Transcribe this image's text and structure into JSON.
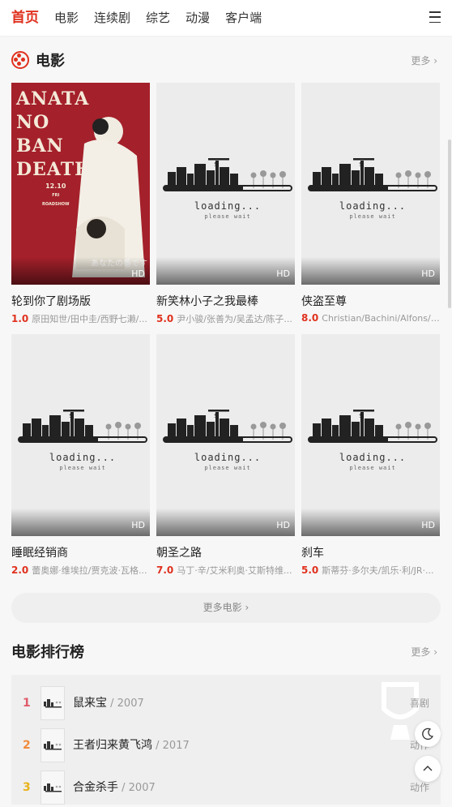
{
  "nav": {
    "items": [
      "首页",
      "电影",
      "连续剧",
      "综艺",
      "动漫",
      "客户端"
    ]
  },
  "movies_section": {
    "title": "电影",
    "more": "更多",
    "more_button": "更多电影",
    "cards": [
      {
        "title": "轮到你了剧场版",
        "score": "1.0",
        "cast": "原田知世/田中圭/西野七濑/...",
        "badge": "HD"
      },
      {
        "title": "新笑林小子之我最棒",
        "score": "5.0",
        "cast": "尹小骏/张善为/吴孟达/陈子...",
        "badge": "HD"
      },
      {
        "title": "侠盗至尊",
        "score": "8.0",
        "cast": "Christian/Bachini/Alfons/C...",
        "badge": "HD"
      },
      {
        "title": "睡眠经销商",
        "score": "2.0",
        "cast": "蕾奥娜·维埃拉/贾克波·瓦格...",
        "badge": "HD"
      },
      {
        "title": "朝圣之路",
        "score": "7.0",
        "cast": "马丁·辛/艾米利奥·艾斯特维...",
        "badge": "HD"
      },
      {
        "title": "刹车",
        "score": "5.0",
        "cast": "斯蒂芬·多尔夫/凯乐·利/JR·...",
        "badge": "HD"
      }
    ],
    "loading_text": "loading...",
    "loading_sub": "please wait",
    "poster_art": {
      "title_lines": [
        "ANATA",
        "NO",
        "BAN",
        "DEATH."
      ],
      "date": "12.10",
      "date_sub": "FRI\nROADSHOW",
      "jp_title": "あなたの番です"
    }
  },
  "ranking_section": {
    "title": "电影排行榜",
    "more": "更多",
    "rows": [
      {
        "rank": "1",
        "name": "鼠来宝",
        "year": "2007",
        "genre": "喜剧",
        "color": "#e05a6a"
      },
      {
        "rank": "2",
        "name": "王者归来黄飞鸿",
        "year": "2017",
        "genre": "动作",
        "color": "#f08a3a"
      },
      {
        "rank": "3",
        "name": "合金杀手",
        "year": "2007",
        "genre": "动作",
        "color": "#e8b318"
      }
    ]
  },
  "icons": [
    "film-icon",
    "menu-icon",
    "moon-icon",
    "arrow-up-icon",
    "chevron-right-icon"
  ],
  "colors": {
    "accent": "#e0311e"
  }
}
